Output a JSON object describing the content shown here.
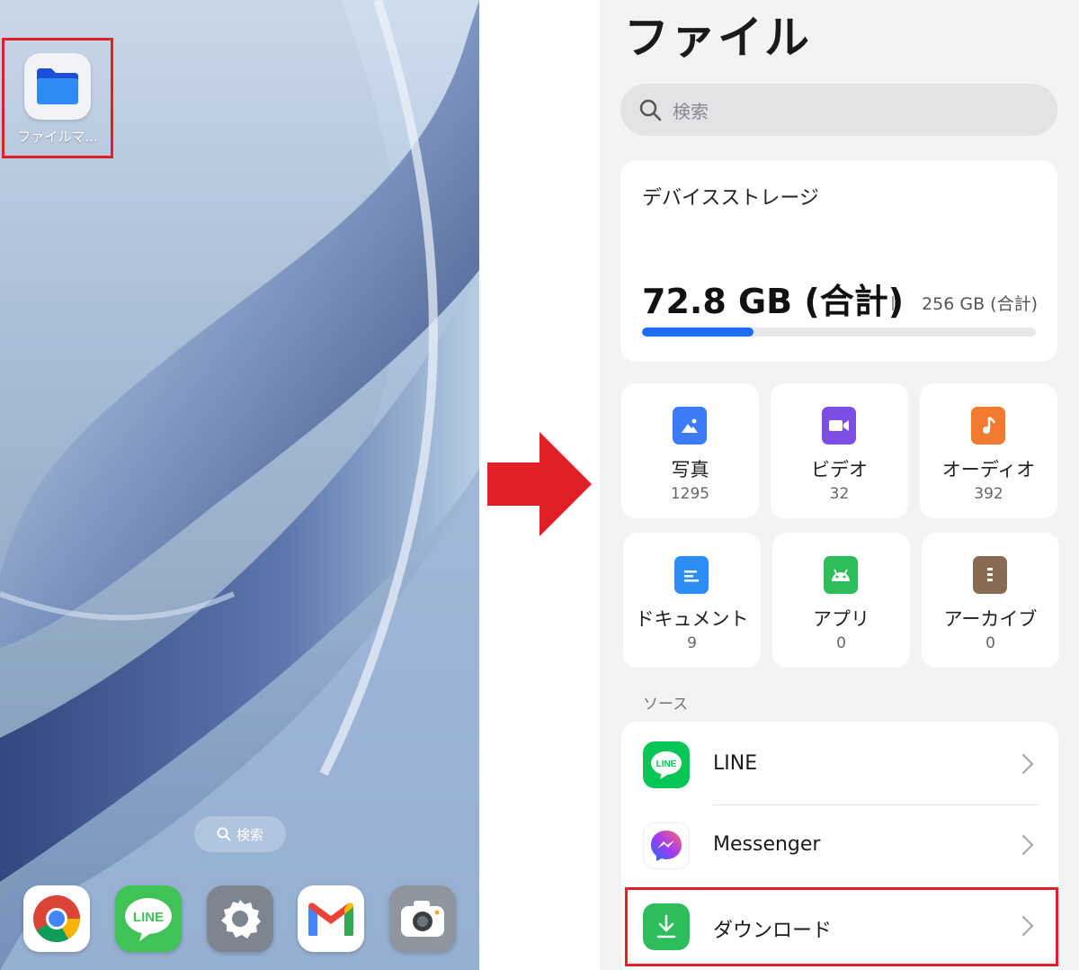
{
  "home": {
    "app_label": "ファイルマ...",
    "search_label": "検索",
    "dock": [
      {
        "name": "chrome-app-icon"
      },
      {
        "name": "line-app-icon",
        "text": "LINE"
      },
      {
        "name": "settings-app-icon"
      },
      {
        "name": "gmail-app-icon"
      },
      {
        "name": "camera-app-icon"
      }
    ]
  },
  "files": {
    "title": "ファイル",
    "search_placeholder": "検索",
    "storage": {
      "title": "デバイスストレージ",
      "used": "72.8 GB (合計)",
      "total": "256 GB (合計)",
      "used_fraction": 0.284
    },
    "categories": [
      {
        "name": "写真",
        "count": "1295",
        "color": "#3b7cf6",
        "icon": "photo-icon"
      },
      {
        "name": "ビデオ",
        "count": "32",
        "color": "#7b4ee8",
        "icon": "video-icon"
      },
      {
        "name": "オーディオ",
        "count": "392",
        "color": "#f07a2e",
        "icon": "audio-icon"
      },
      {
        "name": "ドキュメント",
        "count": "9",
        "color": "#2b8ef5",
        "icon": "document-icon"
      },
      {
        "name": "アプリ",
        "count": "0",
        "color": "#2dbd5a",
        "icon": "android-icon"
      },
      {
        "name": "アーカイブ",
        "count": "0",
        "color": "#8b6a52",
        "icon": "archive-icon"
      }
    ],
    "sources_label": "ソース",
    "sources": [
      {
        "name": "LINE",
        "logo_text": "LINE"
      },
      {
        "name": "Messenger"
      },
      {
        "name": "ダウンロード"
      }
    ]
  }
}
